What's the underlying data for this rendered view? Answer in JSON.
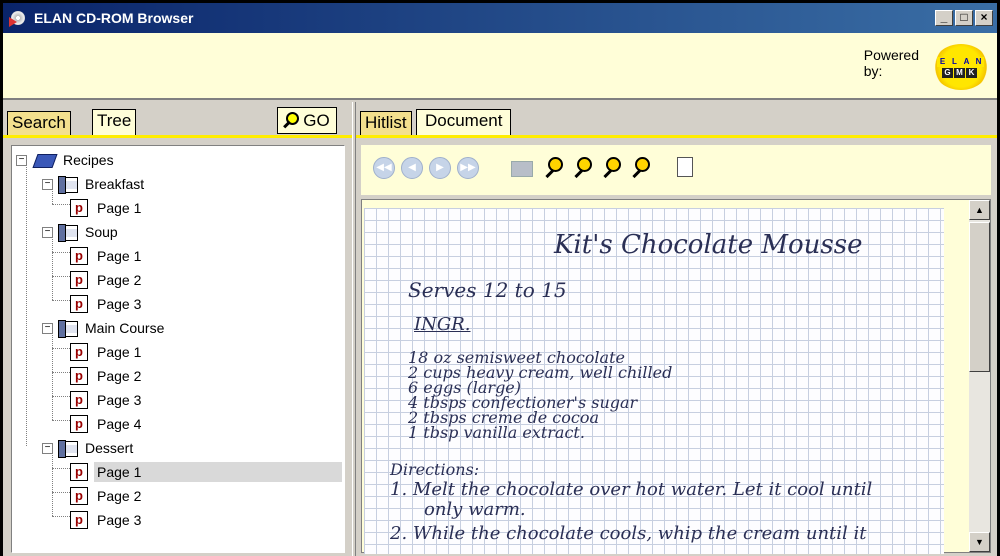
{
  "window": {
    "title": "ELAN CD-ROM Browser",
    "controls": [
      "_",
      "□",
      "×"
    ]
  },
  "header": {
    "powered_line1": "Powered",
    "powered_line2": "by:",
    "logo_top": [
      "E",
      "L",
      "A",
      "N"
    ],
    "logo_bottom": [
      "G",
      "M",
      "K"
    ]
  },
  "left_tabs": {
    "search": "Search",
    "tree": "Tree",
    "go": "GO"
  },
  "right_tabs": {
    "hitlist": "Hitlist",
    "document": "Document"
  },
  "tree": {
    "root": "Recipes",
    "sections": [
      {
        "label": "Breakfast",
        "pages": [
          "Page 1"
        ]
      },
      {
        "label": "Soup",
        "pages": [
          "Page 1",
          "Page 2",
          "Page 3"
        ]
      },
      {
        "label": "Main Course",
        "pages": [
          "Page 1",
          "Page 2",
          "Page 3",
          "Page 4"
        ]
      },
      {
        "label": "Dessert",
        "pages": [
          "Page 1",
          "Page 2",
          "Page 3"
        ]
      }
    ],
    "selected": "Dessert / Page 1"
  },
  "toolbar": {
    "icons": [
      "first-page-icon",
      "prev-page-icon",
      "next-page-icon",
      "last-page-icon",
      "print-icon",
      "zoom-in-icon",
      "zoom-out-icon",
      "zoom-fit-icon",
      "zoom-width-icon",
      "copy-icon"
    ]
  },
  "document": {
    "title": "Kit's Chocolate Mousse",
    "serves": "Serves 12 to 15",
    "ingr_heading": "INGR.",
    "ingredients": [
      "18 oz semisweet chocolate",
      "2 cups heavy cream, well chilled",
      "6 eggs (large)",
      "4 tbsps confectioner's sugar",
      "2 tbsps creme de cocoa",
      "1 tbsp vanilla extract."
    ],
    "directions_heading": "Directions:",
    "directions": [
      "1. Melt the chocolate over hot water. Let it cool until",
      "only warm.",
      "2. While the chocolate cools, whip the cream until it"
    ]
  }
}
